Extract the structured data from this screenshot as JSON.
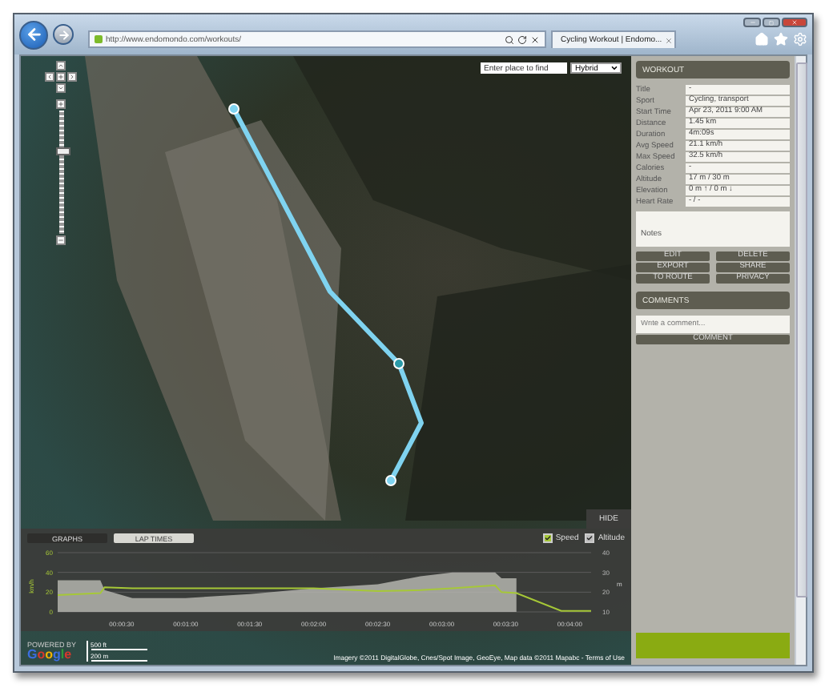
{
  "browser": {
    "address": "http://www.endomondo.com/workouts/",
    "tab_title": "Cycling Workout | Endomo..."
  },
  "map": {
    "search": {
      "placeholder": "Enter place to find"
    },
    "map_type": "Hybrid",
    "hide_button": "HIDE",
    "logo_caption": "POWERED BY",
    "logo": "Google",
    "scale": [
      "500 ft",
      "200 m"
    ],
    "attribution": "Imagery ©2011 DigitalGlobe, Cnes/Spot Image, GeoEye, Map data ©2011 Mapabc - Terms of Use"
  },
  "graph_panel": {
    "tabs": [
      {
        "label": "GRAPHS",
        "selected": true
      },
      {
        "label": "LAP TIMES",
        "selected": false
      }
    ],
    "toggles": [
      {
        "checked": true
      },
      {
        "checked": true
      }
    ],
    "chart_data": {
      "type": "line",
      "ylabel": "km/h",
      "y2label": "m",
      "x": [
        0,
        20,
        22,
        35,
        50,
        60,
        90,
        120,
        150,
        170,
        185,
        205,
        208,
        215,
        236,
        250
      ],
      "series": [
        {
          "name": "Speed",
          "color": "#a6c837",
          "values": [
            17,
            19,
            25,
            24,
            24,
            24,
            24,
            24,
            21,
            22,
            24,
            27,
            20,
            19,
            1,
            1
          ]
        },
        {
          "name": "Altitude",
          "color": "#b4b4ae",
          "type": "area",
          "axis": "y2",
          "values": [
            26,
            26,
            21,
            17,
            17,
            17,
            19,
            22,
            24,
            28,
            30,
            30,
            27,
            27,
            null,
            null
          ]
        }
      ],
      "xlim": [
        0,
        250
      ],
      "ylim": [
        0,
        60
      ],
      "y2lim": [
        10,
        40
      ],
      "xticks": [
        {
          "value": 30,
          "label": "00:00:30"
        },
        {
          "value": 60,
          "label": "00:01:00"
        },
        {
          "value": 90,
          "label": "00:01:30"
        },
        {
          "value": 120,
          "label": "00:02:00"
        },
        {
          "value": 150,
          "label": "00:02:30"
        },
        {
          "value": 180,
          "label": "00:03:00"
        },
        {
          "value": 210,
          "label": "00:03:30"
        },
        {
          "value": 240,
          "label": "00:04:00"
        }
      ],
      "yticks": [
        0,
        20,
        40,
        60
      ],
      "y2ticks": [
        10,
        20,
        30,
        40
      ]
    }
  },
  "workout": {
    "title": "WORKOUT",
    "fields": [
      {
        "label": "Title",
        "value": "-"
      },
      {
        "label": "Sport",
        "value": "Cycling, transport"
      },
      {
        "label": "Start Time",
        "value": "Apr 23, 2011 9:00 AM"
      },
      {
        "label": "Distance",
        "value": "1.45 km"
      },
      {
        "label": "Duration",
        "value": "4m:09s"
      },
      {
        "label": "Avg Speed",
        "value": "21.1 km/h"
      },
      {
        "label": "Max Speed",
        "value": "32.5 km/h"
      },
      {
        "label": "Calories",
        "value": "-"
      },
      {
        "label": "Altitude",
        "value": "17 m / 30 m"
      },
      {
        "label": "Elevation",
        "value": "0 m ↑ / 0 m ↓"
      },
      {
        "label": "Heart Rate",
        "value": "- / -"
      }
    ],
    "notes_label": "Notes",
    "buttons": [
      "EDIT",
      "DELETE",
      "EXPORT",
      "SHARE",
      "TO ROUTE",
      "PRIVACY"
    ]
  },
  "comments": {
    "title": "COMMENTS",
    "placeholder": "Write a comment...",
    "button": "COMMENT"
  }
}
